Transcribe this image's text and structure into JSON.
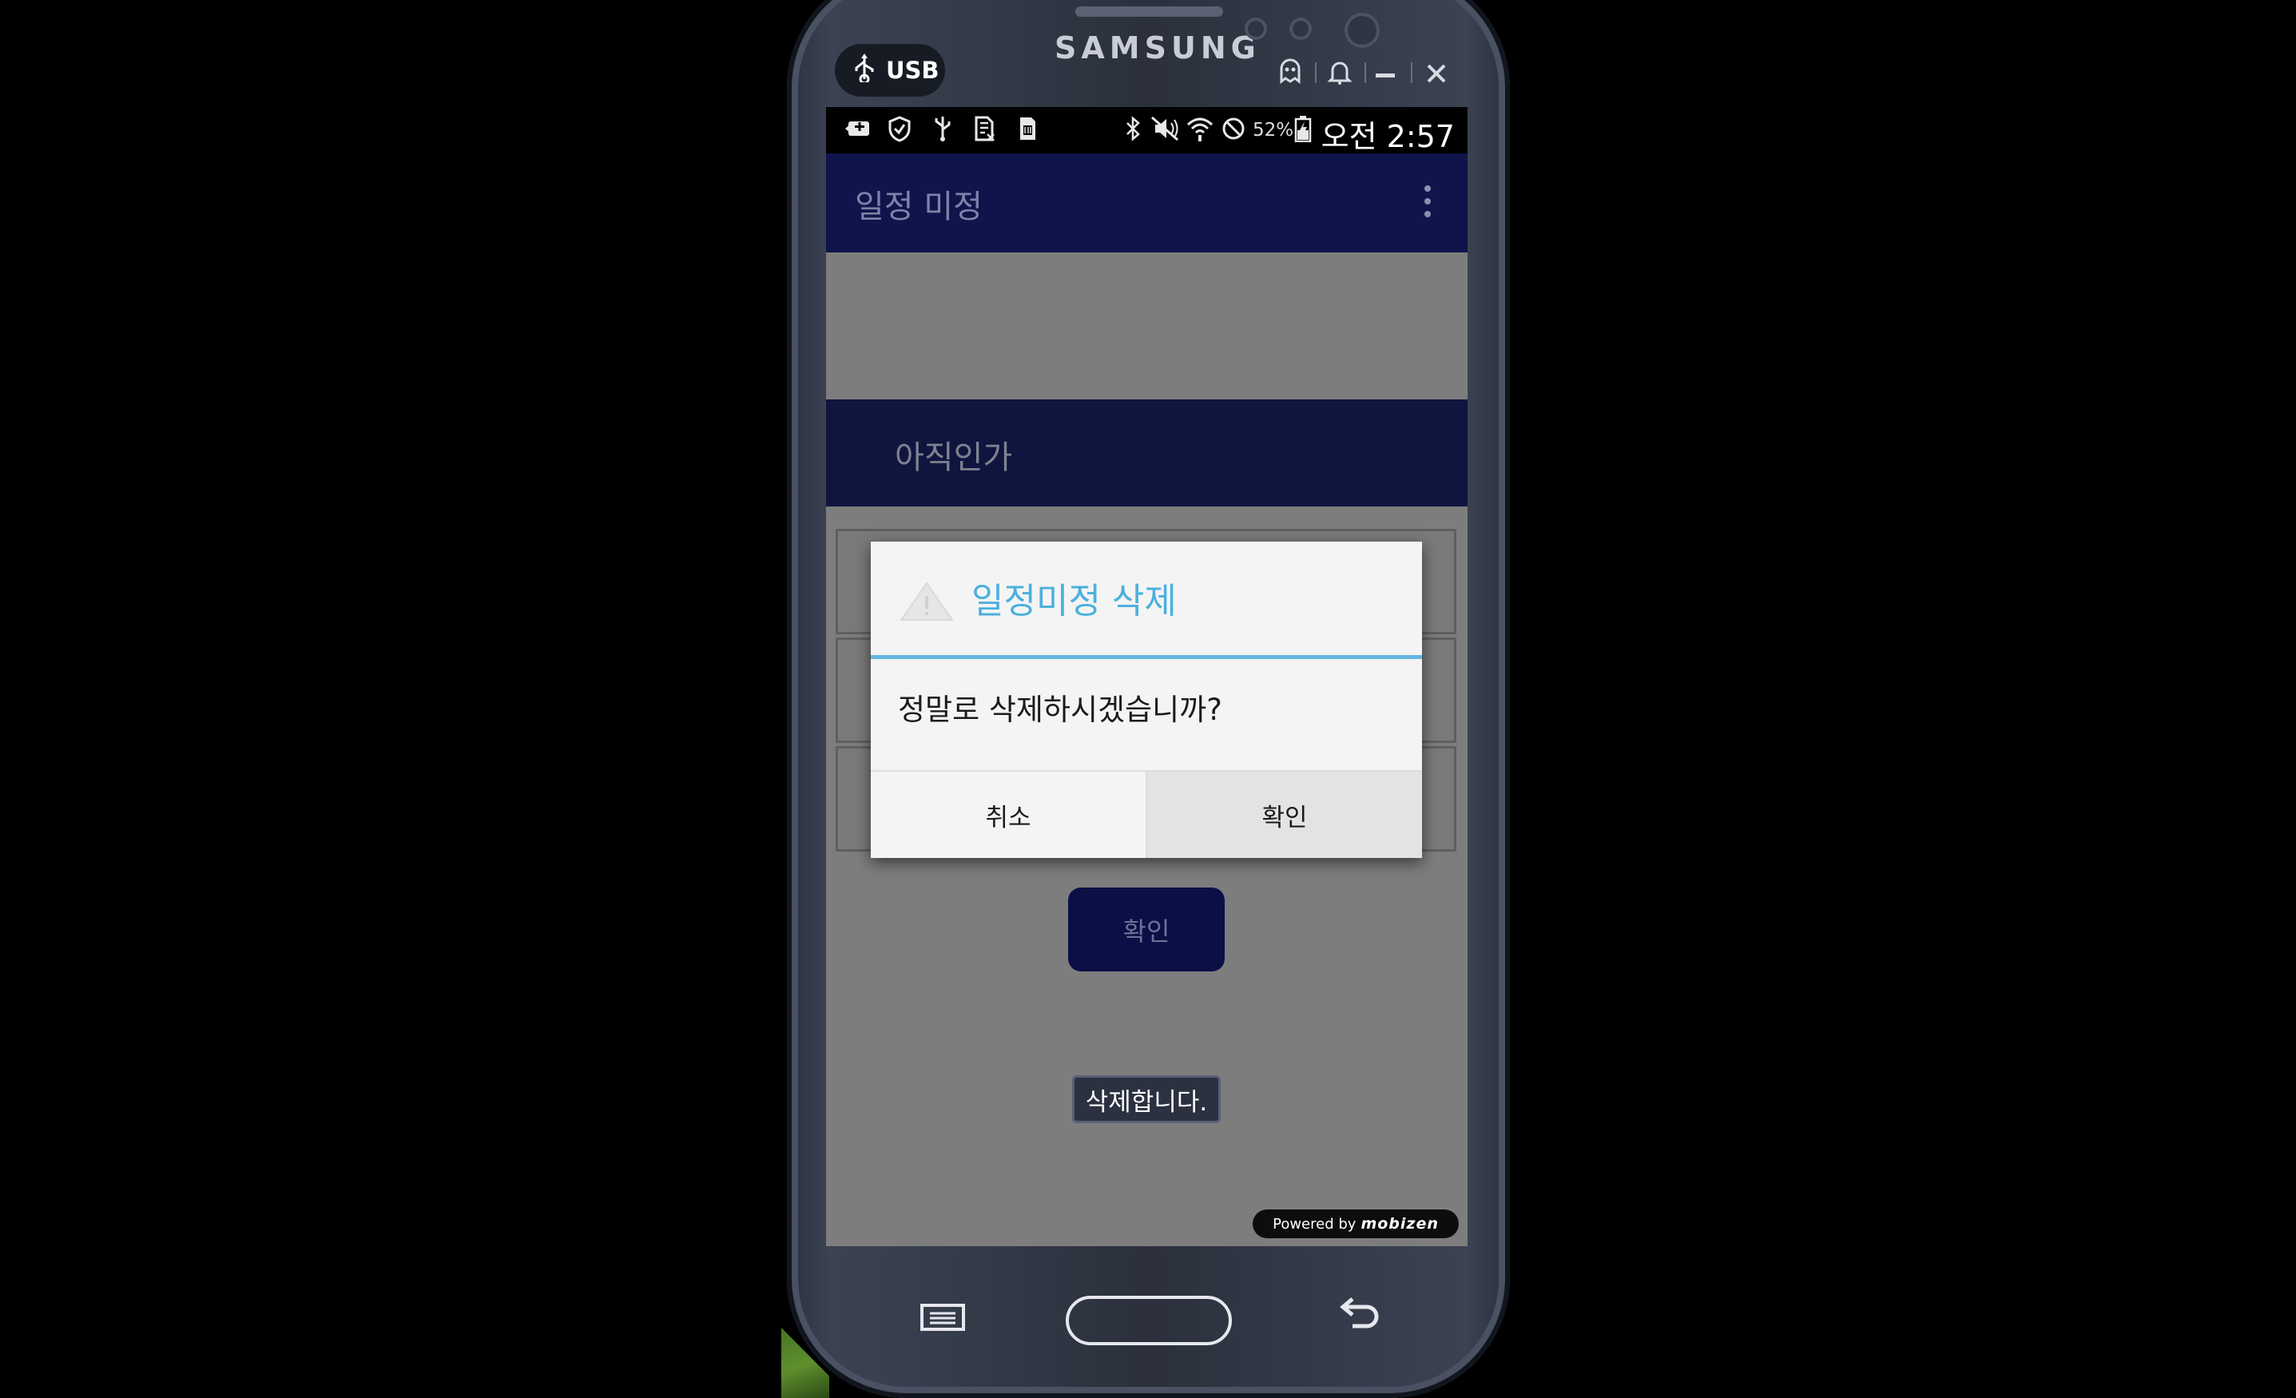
{
  "device": {
    "brand": "SAMSUNG"
  },
  "emulator_bar": {
    "usb_label": "USB",
    "controls": [
      "ghost-icon",
      "bell-icon",
      "minimize-icon",
      "close-icon"
    ]
  },
  "status_bar": {
    "battery": "52%",
    "time": "오전 2:57",
    "icons": [
      "screenshot-icon",
      "shield-icon",
      "usb-icon",
      "sd-card-icon",
      "sim-icon",
      "bluetooth-icon",
      "mute-icon",
      "wifi-icon",
      "blocked-icon",
      "battery-icon"
    ]
  },
  "action_bar": {
    "title": "일정 미정"
  },
  "section": {
    "header": "아직인가"
  },
  "main": {
    "confirm_button": "확인"
  },
  "dialog": {
    "title": "일정미정 삭제",
    "message": "정말로 삭제하시겠습니까?",
    "cancel_label": "취소",
    "ok_label": "확인"
  },
  "toast": {
    "text": "삭제합니다."
  },
  "watermark": {
    "prefix": "Powered by",
    "logo": "mobizen"
  },
  "colors": {
    "action_bar": "#0f144b",
    "dialog_title": "#4cb0dd",
    "dim_background": "#7d7d7d"
  }
}
